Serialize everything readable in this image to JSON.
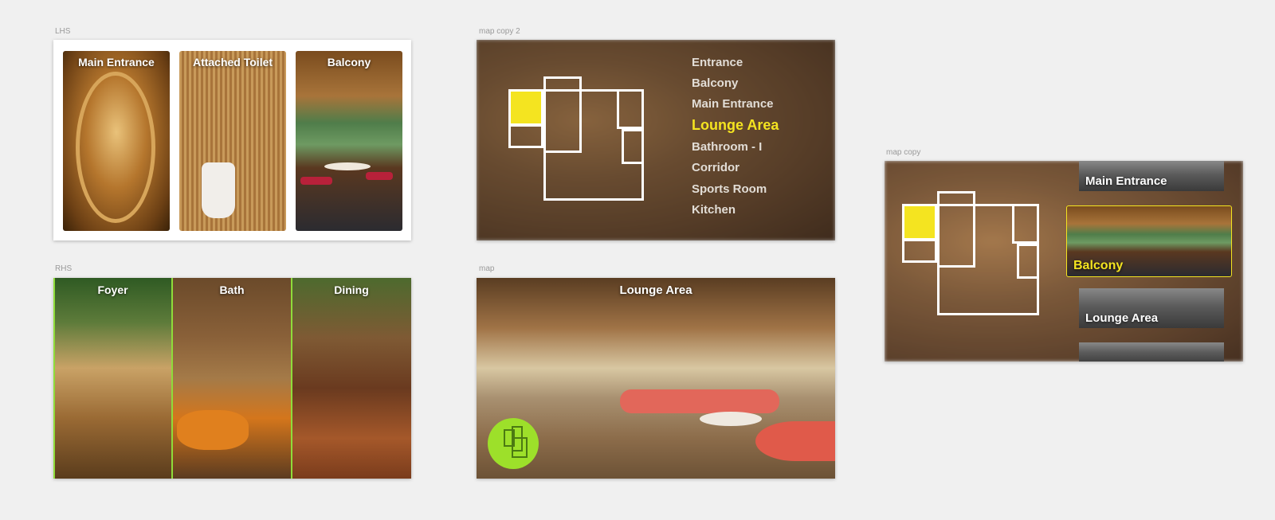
{
  "artboards": {
    "lhs": {
      "label": "LHS",
      "cards": [
        {
          "caption": "Main Entrance"
        },
        {
          "caption": "Attached Toilet"
        },
        {
          "caption": "Balcony"
        }
      ]
    },
    "rhs": {
      "label": "RHS",
      "cards": [
        {
          "caption": "Foyer"
        },
        {
          "caption": "Bath"
        },
        {
          "caption": "Dining"
        }
      ]
    },
    "map_copy_2": {
      "label": "map copy 2",
      "legend": [
        "Entrance",
        "Balcony",
        "Main Entrance",
        "Lounge Area",
        "Bathroom - I",
        "Corridor",
        "Sports Room",
        "Kitchen"
      ],
      "active": "Lounge Area"
    },
    "map": {
      "label": "map",
      "title": "Lounge Area"
    },
    "map_copy": {
      "label": "map copy",
      "thumbs": [
        "Main Entrance",
        "Balcony",
        "Lounge Area",
        ""
      ],
      "active": "Balcony"
    }
  },
  "colors": {
    "accent_yellow": "#f4e420",
    "accent_green": "#9de02a",
    "background": "#f0f0f0"
  }
}
